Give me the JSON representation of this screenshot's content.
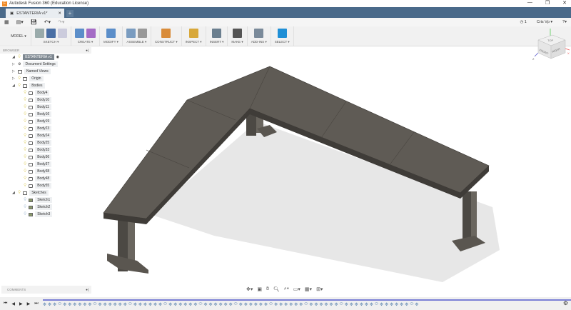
{
  "window": {
    "title": "Autodesk Fusion 360 (Education License)",
    "minimize": "—",
    "restore": "❐",
    "close": "✕"
  },
  "tab": {
    "label": "ESTANTERIA v1*",
    "close": "✕",
    "new": "+"
  },
  "quickbar": {
    "jobs": "1",
    "user": "Cris Vp ▾",
    "help": "?▾"
  },
  "toolbar": {
    "workspace": "MODEL ▾",
    "groups": [
      {
        "label": "SKETCH ▾",
        "colors": [
          "#9aa",
          "#4a6fa5",
          "#ccd"
        ]
      },
      {
        "label": "CREATE ▾",
        "colors": [
          "#5b8ec9",
          "#a46bc5"
        ]
      },
      {
        "label": "MODIFY ▾",
        "colors": [
          "#5b8ec9"
        ]
      },
      {
        "label": "ASSEMBLE ▾",
        "colors": [
          "#7a9cc0",
          "#999"
        ]
      },
      {
        "label": "CONSTRUCT ▾",
        "colors": [
          "#d98c3a"
        ]
      },
      {
        "label": "INSPECT ▾",
        "colors": [
          "#d8a83a"
        ]
      },
      {
        "label": "INSERT ▾",
        "colors": [
          "#6b7f8f"
        ]
      },
      {
        "label": "MAKE ▾",
        "colors": [
          "#555"
        ]
      },
      {
        "label": "ADD-INS ▾",
        "colors": [
          "#7a8a9a"
        ]
      },
      {
        "label": "SELECT ▾",
        "colors": [
          "#1f8fd6"
        ]
      }
    ]
  },
  "browser": {
    "title": "BROWSER",
    "root": "ESTANTERIA v1",
    "items": [
      {
        "label": "Document Settings"
      },
      {
        "label": "Named Views"
      },
      {
        "label": "Origin"
      }
    ],
    "bodies_folder": "Bodies",
    "bodies": [
      "Body4",
      "Body10",
      "Body11",
      "Body16",
      "Body19",
      "Body23",
      "Body24",
      "Body25",
      "Body33",
      "Body36",
      "Body37",
      "Body38",
      "Body48",
      "Body55"
    ],
    "sketches_folder": "Sketches",
    "sketches": [
      "Sketch1",
      "Sketch2",
      "Sketch3"
    ]
  },
  "comments": {
    "title": "COMMENTS"
  },
  "viewcube": {
    "top": "TOP",
    "front": "FRONT",
    "right": "RIGHT",
    "z": "Z",
    "x": "X",
    "y": "Y"
  },
  "timeline": {
    "controls": [
      "⏮",
      "◀",
      "▶",
      "▶",
      "⏭"
    ]
  },
  "colors": {
    "model_top": "#5e5a54",
    "model_side": "#3f3c38",
    "shadow": "#e6e6e6",
    "accent": "#4a6a8a"
  }
}
